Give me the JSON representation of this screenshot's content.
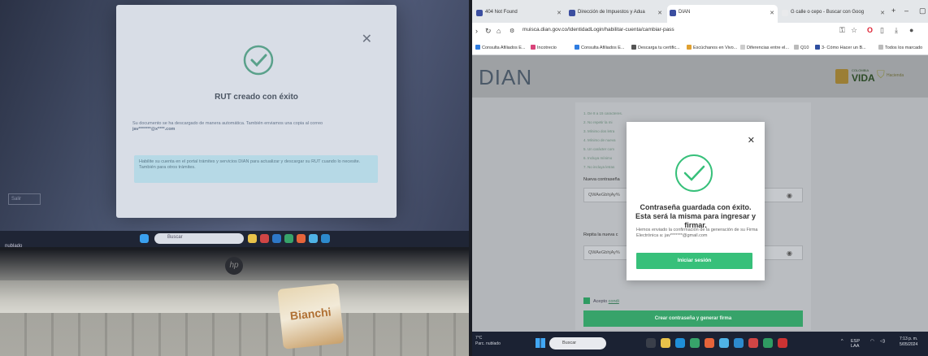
{
  "photo": {
    "modal": {
      "title": "RUT creado con éxito",
      "message": "Su documento se ha descargado de manera automática. También enviamos una copia al correo",
      "email": "jav*******@x****.com",
      "info_text": "Habilite su cuenta en el portal trámites y servicios DIAN para actualizar y descargar su RUT cuando lo necesite. También para otros trámites."
    },
    "left_button": "Salir",
    "taskbar_search": "Buscar",
    "caption": "nublado",
    "brand": "hp",
    "candy": "Bianchi"
  },
  "browser": {
    "tabs": [
      {
        "label": "404 Not Found"
      },
      {
        "label": "Dirección de Impuestos y Adua"
      },
      {
        "label": "DIAN"
      },
      {
        "label": "G calle o cepo - Buscar con Goog"
      }
    ],
    "new_tab": "+",
    "url": "muisca.dian.gov.co/IdentidadLogin/habilitar-cuenta/cambiar-pass",
    "bookmarks": [
      "Consulta Afiliados E...",
      "Incotrecio",
      "Consulta Afiliados E...",
      "Descarga tu certific...",
      "Escúchanos en Vivo...",
      "Diferencias entre el...",
      "Q10",
      "3- Cómo Hacer un B..."
    ],
    "bookmarks_more": "Todos los marcado"
  },
  "site": {
    "logo": "DIAN",
    "colombia_small": "COLOMBIA",
    "colombia_big": "VIDA",
    "hacienda": "Hacienda",
    "rules": [
      "1. De 8 a 15 caracteres.",
      "2. No repetir la mi",
      "3. Mínimo dos letra",
      "4. Mínimo de nueva",
      "5. Un carácter com",
      "6. Incluya mínimo",
      "7. No incluya letras"
    ],
    "new_password_label": "Nueva contraseña",
    "new_password_value": "QWAeGbhjAy%",
    "repeat_label": "Repita la nueva c",
    "repeat_value": "QWAeGbhjAy%",
    "accept_text": "Acepto",
    "accept_link": "condi",
    "create_button": "Crear contraseña y generar firma"
  },
  "dialog": {
    "title": "Contraseña guardada con éxito. Esta será la misma para ingresar y firmar.",
    "message": "Hemos enviado la confirmación de la generación de su Firma Electrónica a: jav*******@gmail.com",
    "button": "Iniciar sesión"
  },
  "taskbar": {
    "pc_line1": "7°C",
    "pc_line2": "Parc. nublado",
    "search": "Buscar",
    "lang1": "ESP",
    "lang2": "LAA",
    "time": "7:13 p. m.",
    "date": "5/05/2024"
  },
  "colors": {
    "accent_green": "#37c07a",
    "dian_gray": "#4b5968"
  }
}
